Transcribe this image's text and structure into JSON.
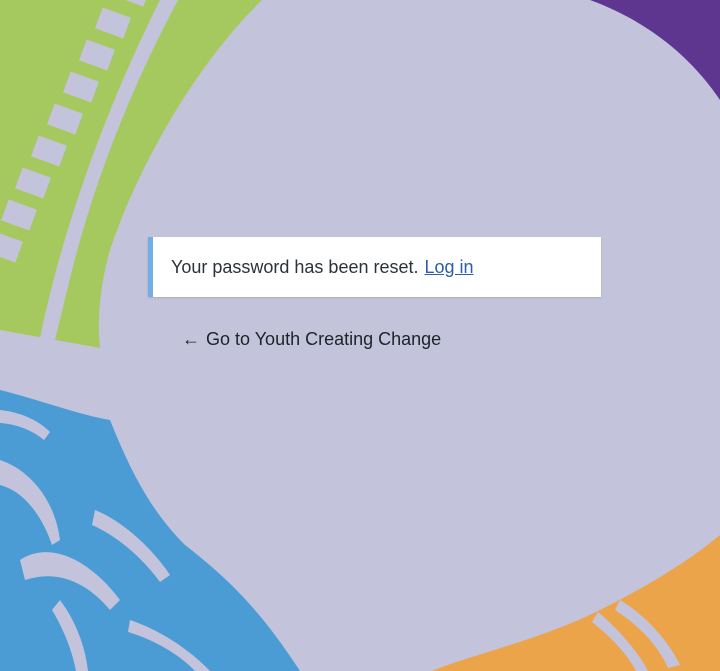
{
  "notice": {
    "message": "Your password has been reset.",
    "login_link": "Log in"
  },
  "back_link": {
    "arrow": "←",
    "label": "Go to Youth Creating Change"
  },
  "colors": {
    "background": "#c3c4db",
    "green": "#a6c95f",
    "purple": "#5e3690",
    "blue": "#4b9bd5",
    "orange": "#eba449",
    "notice_accent": "#72aee6",
    "link": "#2a5ea8"
  }
}
